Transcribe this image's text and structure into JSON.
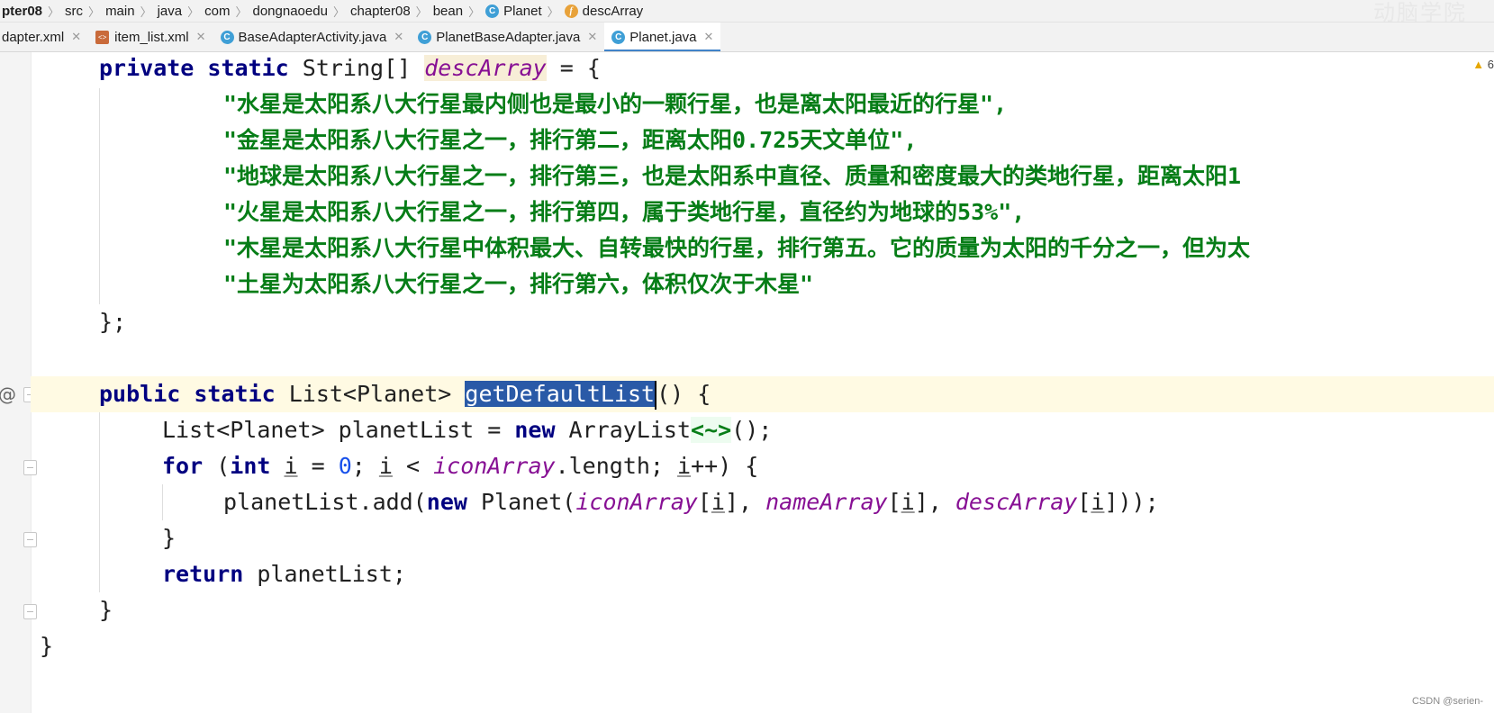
{
  "breadcrumb": [
    "pter08",
    "src",
    "main",
    "java",
    "com",
    "dongnaoedu",
    "chapter08",
    "bean",
    "Planet",
    "descArray"
  ],
  "watermark": "动脑学院",
  "tabs": [
    "dapter.xml",
    "item_list.xml",
    "BaseAdapterActivity.java",
    "PlanetBaseAdapter.java",
    "Planet.java"
  ],
  "active_tab": "Planet.java",
  "warning_count": "6",
  "code": {
    "l1": {
      "kw": "private static",
      "type": " String[] ",
      "name": "descArray",
      "rest": " = {"
    },
    "strings": [
      "\"水星是太阳系八大行星最内侧也是最小的一颗行星，也是离太阳最近的行星\",",
      "\"金星是太阳系八大行星之一，排行第二，距离太阳0.725天文单位\",",
      "\"地球是太阳系八大行星之一，排行第三，也是太阳系中直径、质量和密度最大的类地行星，距离太阳1",
      "\"火星是太阳系八大行星之一，排行第四，属于类地行星，直径约为地球的53%\",",
      "\"木星是太阳系八大行星中体积最大、自转最快的行星，排行第五。它的质量为太阳的千分之一，但为太",
      "\"土星为太阳系八大行星之一，排行第六，体积仅次于木星\""
    ],
    "close_array": "};",
    "method": {
      "kw": "public static",
      "type": " List<Planet> ",
      "name": "getDefaultList",
      "rest": "() {"
    },
    "list_decl": {
      "pre": "List<Planet> planetList = ",
      "kw": "new",
      "mid": " ArrayList",
      "gen": "<~>",
      "post": "();"
    },
    "for_line": {
      "kw1": "for",
      "p1": " (",
      "kw2": "int",
      "sp": " ",
      "i1": "i",
      "p2": " = ",
      "zero": "0",
      "p3": "; ",
      "i2": "i",
      "p4": " < ",
      "icon": "iconArray",
      "p5": ".length; ",
      "i3": "i",
      "p6": "++) {"
    },
    "add_line": {
      "pre": "planetList.add(",
      "kw": "new",
      "mid": " Planet(",
      "icon": "iconArray",
      "b1": "[",
      "i1": "i",
      "b2": "], ",
      "name": "nameArray",
      "b3": "[",
      "i2": "i",
      "b4": "], ",
      "desc": "descArray",
      "b5": "[",
      "i3": "i",
      "b6": "]));"
    },
    "close_for": "}",
    "return_line": {
      "kw": "return",
      "rest": " planetList;"
    },
    "close_method": "}",
    "close_class": "}"
  },
  "credit": "CSDN @serien-"
}
